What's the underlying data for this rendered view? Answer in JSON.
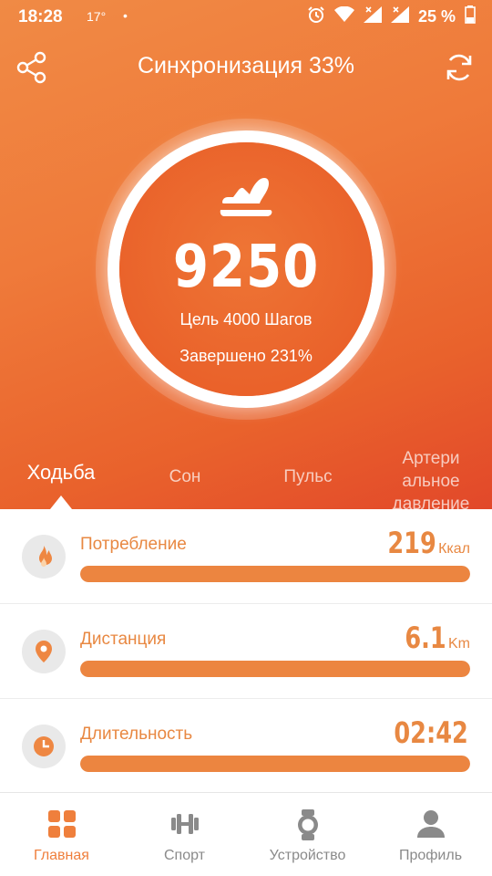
{
  "status_bar": {
    "time": "18:28",
    "temperature": "17°",
    "dot": "•",
    "battery_percent": "25 %",
    "icons": [
      "alarm-icon",
      "wifi-icon",
      "signal-icon",
      "signal-icon",
      "battery-icon"
    ]
  },
  "header": {
    "title": "Синхронизация 33%",
    "share_icon": "share-icon",
    "sync_icon": "sync-icon"
  },
  "summary": {
    "steps": "9250",
    "goal": "Цель 4000 Шагов",
    "completed": "Завершено 231%",
    "icon": "shoe-icon"
  },
  "tabs": [
    {
      "label": "Ходьба",
      "active": true
    },
    {
      "label": "Сон",
      "active": false
    },
    {
      "label": "Пульс",
      "active": false
    },
    {
      "label": "Артери альное давление",
      "active": false
    }
  ],
  "metrics": [
    {
      "label": "Потребление",
      "value": "219",
      "unit": "Ккал",
      "icon": "flame-icon",
      "progress": 1.0
    },
    {
      "label": "Дистанция",
      "value": "6.1",
      "unit": "Km",
      "icon": "location-pin-icon",
      "progress": 1.0
    },
    {
      "label": "Длительность",
      "value": "02:42",
      "unit": "",
      "icon": "clock-icon",
      "progress": 1.0
    }
  ],
  "bottom_nav": [
    {
      "label": "Главная",
      "icon": "grid-icon",
      "active": true
    },
    {
      "label": "Спорт",
      "icon": "dumbbell-icon",
      "active": false
    },
    {
      "label": "Устройство",
      "icon": "watch-icon",
      "active": false
    },
    {
      "label": "Профиль",
      "icon": "person-icon",
      "active": false
    }
  ],
  "colors": {
    "accent": "#ef7f3c",
    "hero_start": "#f08a45",
    "hero_end": "#e2482a",
    "inactive_icon": "#8a8a8a"
  }
}
